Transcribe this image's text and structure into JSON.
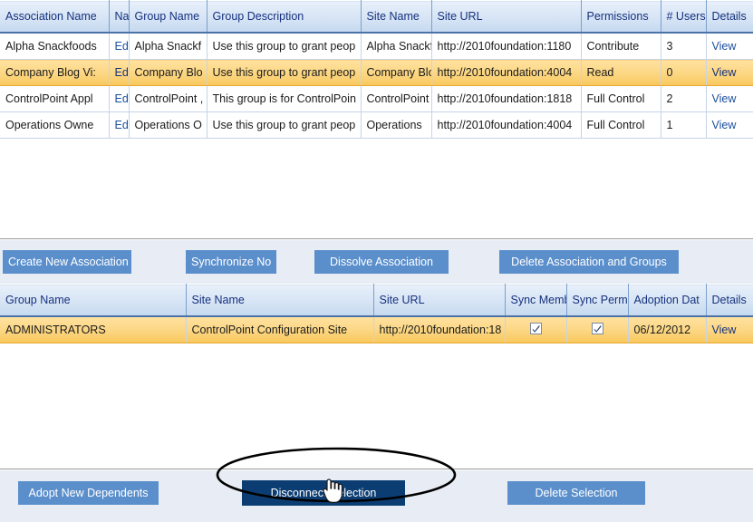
{
  "colors": {
    "header_gradient_top": "#e8f0fa",
    "header_gradient_bottom": "#c6d9ef",
    "header_text": "#15317e",
    "header_underline": "#4b73a8",
    "row_selected": "#f8c85e",
    "button_blue": "#5b8fcc",
    "button_dark_navy": "#0b3d73",
    "button_bar_bg": "#e8edf5",
    "grid_line": "#c5d4e8",
    "link": "#1b4fa0",
    "annotation_stroke": "#000000"
  },
  "associations_grid": {
    "name": "associations-grid",
    "columns": [
      "Association Name",
      "Name",
      "Group Name",
      "Group Description",
      "Site Name",
      "Site URL",
      "Permissions",
      "# Users",
      "Details"
    ],
    "rows": [
      {
        "association_name": "Alpha Snackfoods",
        "edit": "Edit",
        "group_name": "Alpha Snackf",
        "group_description": "Use this group to grant peop",
        "site_name": "Alpha Snackf",
        "site_url": "http://2010foundation:1180",
        "permissions": "Contribute",
        "users": "3",
        "details": "View",
        "selected": false
      },
      {
        "association_name": "Company Blog Vi:",
        "edit": "Edit",
        "group_name": "Company Blo",
        "group_description": "Use this group to grant peop",
        "site_name": "Company Blo",
        "site_url": "http://2010foundation:4004",
        "permissions": "Read",
        "users": "0",
        "details": "View",
        "selected": true
      },
      {
        "association_name": "ControlPoint Appl",
        "edit": "Edit",
        "group_name": "ControlPoint ,",
        "group_description": "This group is for ControlPoin",
        "site_name": "ControlPoint",
        "site_url": "http://2010foundation:1818",
        "permissions": "Full Control",
        "users": "2",
        "details": "View",
        "selected": false
      },
      {
        "association_name": "Operations Owne",
        "edit": "Edit",
        "group_name": "Operations O",
        "group_description": "Use this group to grant peop",
        "site_name": "Operations",
        "site_url": "http://2010foundation:4004",
        "permissions": "Full Control",
        "users": "1",
        "details": "View",
        "selected": false
      }
    ]
  },
  "association_actions": {
    "create_new_association": "Create New Association",
    "synchronize_now": "Synchronize No",
    "dissolve_association": "Dissolve Association",
    "delete_association_and_groups": "Delete Association and Groups"
  },
  "dependents_grid": {
    "name": "dependents-grid",
    "columns": [
      "Group Name",
      "Site Name",
      "Site URL",
      "Sync Memb",
      "Sync Permi",
      "Adoption Dat",
      "Details"
    ],
    "rows": [
      {
        "group_name": "ADMINISTRATORS",
        "site_name": "ControlPoint Configuration Site",
        "site_url": "http://2010foundation:18",
        "sync_members": true,
        "sync_permissions": true,
        "adoption_date": "06/12/2012",
        "details": "View",
        "selected": true
      }
    ]
  },
  "dependent_actions": {
    "adopt_new_dependents": "Adopt New Dependents",
    "disconnect_selection": "Disconnect Selection",
    "delete_selection": "Delete Selection"
  },
  "annotation": {
    "ellipse_target": "disconnect-selection-button",
    "cursor": "hand-pointer-cursor"
  }
}
